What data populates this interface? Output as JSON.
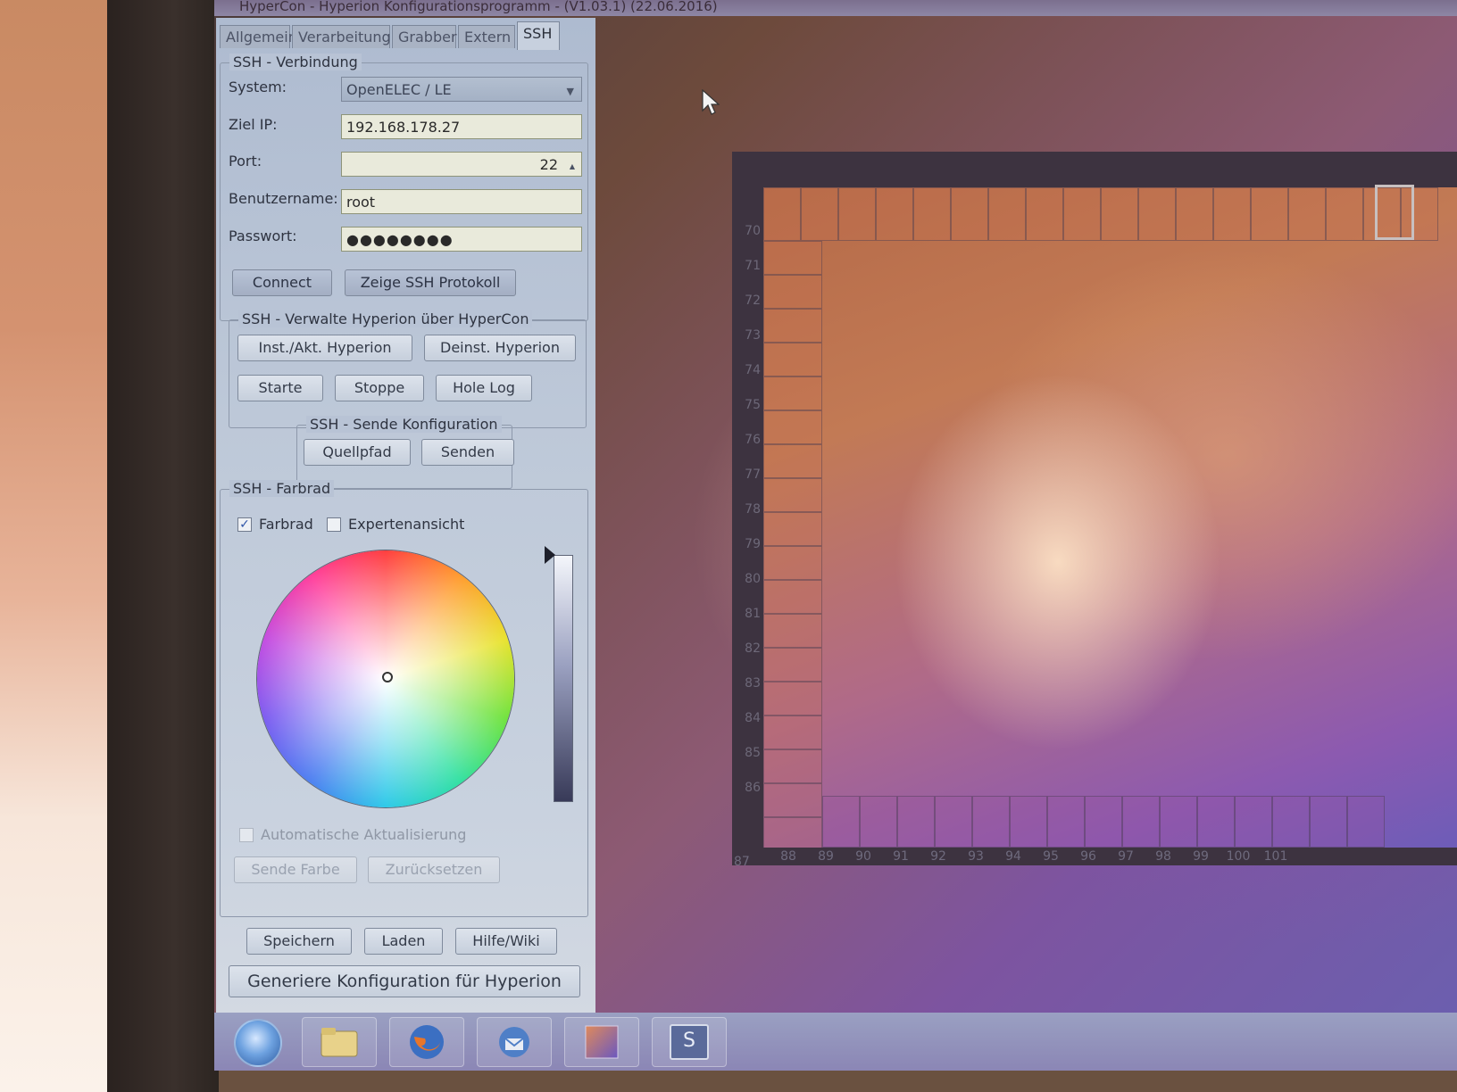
{
  "window": {
    "title": "HyperCon - Hyperion Konfigurationsprogramm - (V1.03.1) (22.06.2016)"
  },
  "tabs": [
    {
      "label": "Allgemein"
    },
    {
      "label": "Verarbeitung"
    },
    {
      "label": "Grabber"
    },
    {
      "label": "Extern"
    },
    {
      "label": "SSH"
    }
  ],
  "ssh_connection": {
    "legend": "SSH - Verbindung",
    "system_label": "System:",
    "system_value": "OpenELEC / LE",
    "ip_label": "Ziel IP:",
    "ip_value": "192.168.178.27",
    "port_label": "Port:",
    "port_value": "22",
    "user_label": "Benutzername:",
    "user_value": "root",
    "password_label": "Passwort:",
    "password_value": "●●●●●●●●",
    "connect_label": "Connect",
    "show_log_label": "Zeige SSH Protokoll"
  },
  "ssh_manage": {
    "legend": "SSH - Verwalte Hyperion über HyperCon",
    "install_label": "Inst./Akt. Hyperion",
    "uninstall_label": "Deinst. Hyperion",
    "start_label": "Starte",
    "stop_label": "Stoppe",
    "get_log_label": "Hole Log"
  },
  "ssh_send_config": {
    "legend": "SSH - Sende Konfiguration",
    "source_label": "Quellpfad",
    "send_label": "Senden"
  },
  "ssh_colorwheel": {
    "legend": "SSH - Farbrad",
    "colorwheel_label": "Farbrad",
    "colorwheel_checked": true,
    "expert_label": "Expertenansicht",
    "expert_checked": false,
    "auto_update_label": "Automatische Aktualisierung",
    "auto_update_checked": false,
    "send_color_label": "Sende Farbe",
    "reset_label": "Zurücksetzen"
  },
  "footer": {
    "save_label": "Speichern",
    "load_label": "Laden",
    "help_label": "Hilfe/Wiki",
    "generate_label": "Generiere Konfiguration für Hyperion"
  },
  "preview": {
    "left_ticks": [
      "70",
      "71",
      "72",
      "73",
      "74",
      "75",
      "76",
      "77",
      "78",
      "79",
      "80",
      "81",
      "82",
      "83",
      "84",
      "85",
      "86"
    ],
    "corner_tick": "87",
    "bottom_ticks": [
      "88",
      "89",
      "90",
      "91",
      "92",
      "93",
      "94",
      "95",
      "96",
      "97",
      "98",
      "99",
      "100",
      "101"
    ]
  },
  "taskbar": {
    "items": [
      {
        "icon": "explorer-folder-icon"
      },
      {
        "icon": "firefox-icon"
      },
      {
        "icon": "thunderbird-icon"
      },
      {
        "icon": "hypercon-app-icon"
      },
      {
        "icon": "putty-s-icon"
      }
    ],
    "s_icon_text": "S"
  }
}
